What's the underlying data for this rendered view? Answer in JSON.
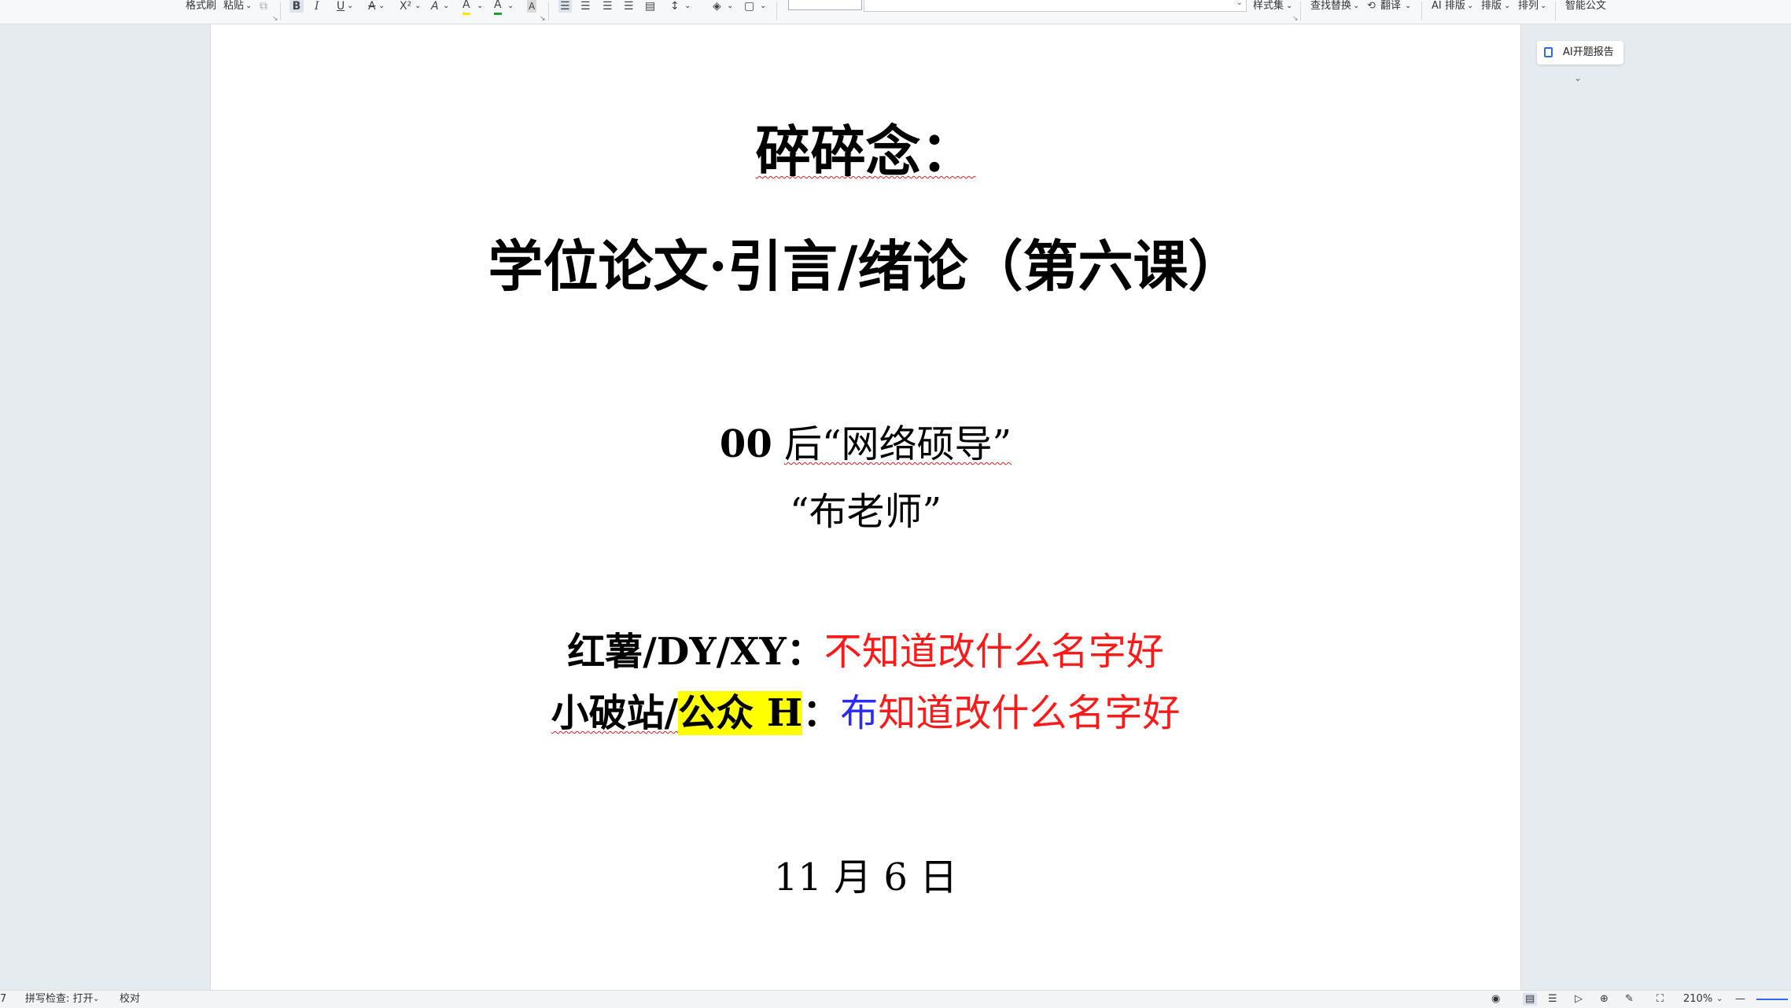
{
  "toolbar": {
    "format_painter": "格式刷",
    "paste": "粘贴",
    "bold": "B",
    "italic": "I",
    "underline": "U",
    "strikethrough": "A",
    "superscript": "X²",
    "text_effect": "A",
    "highlight": "A",
    "font_color": "A",
    "char_shading": "A",
    "style_set": "样式集",
    "find_replace": "查找替换",
    "translate": "翻译",
    "ai_layout": "AI 排版",
    "layout": "排版",
    "arrange": "排列",
    "smart_doc": "智能公文",
    "dropdown": "⌄"
  },
  "document": {
    "title_line1": "碎碎念：",
    "title_line2": "学位论文·引言/绪论（第六课）",
    "author_line1_bold": "00",
    "author_line1_rest": "后“网络硕导”",
    "author_line2": "“布老师”",
    "social1_label": "红薯/DY/XY：",
    "social1_value": "不知道改什么名字好",
    "social2_label_a": "小破站/",
    "social2_label_highlight": "公众 H",
    "social2_colon": "：",
    "social2_blue": "布",
    "social2_value": "知道改什么名字好",
    "date": "11 月 6 日"
  },
  "side_pane": {
    "ai_report": "AI开题报告",
    "expand": "⌄"
  },
  "statusbar": {
    "page_fragment": "7",
    "spell_check": "拼写检查: 打开",
    "proofread": "校对",
    "zoom": "210%",
    "zoom_minus": "—"
  }
}
